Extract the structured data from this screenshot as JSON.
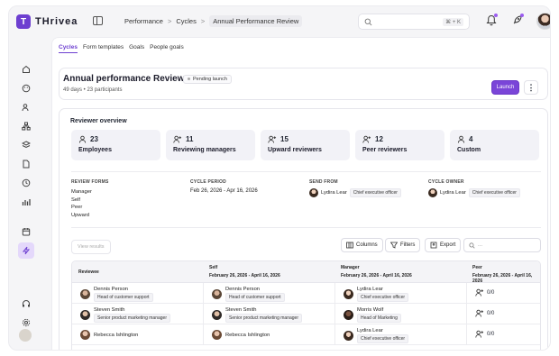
{
  "app": {
    "brand": "THrivea",
    "brand_initial": "T"
  },
  "breadcrumb": [
    "Performance",
    "Cycles",
    "Annual Performance Review"
  ],
  "breadcrumb_sep": ">",
  "search": {
    "shortcut": "⌘ + K"
  },
  "subtabs": [
    "Cycles",
    "Form templates",
    "Goals",
    "People goals"
  ],
  "cycle": {
    "title": "Annual performance Review",
    "status": "Pending launch",
    "meta": "49 days • 23 participants",
    "launch_label": "Launch",
    "more_label": "⋮"
  },
  "overview": {
    "title": "Reviewer overview",
    "stats": [
      {
        "count": "23",
        "label": "Employees",
        "icon": "user-icon"
      },
      {
        "count": "11",
        "label": "Reviewing managers",
        "icon": "user-plus-icon"
      },
      {
        "count": "15",
        "label": "Upward reviewers",
        "icon": "user-plus-icon"
      },
      {
        "count": "12",
        "label": "Peer reviewers",
        "icon": "user-plus-icon"
      },
      {
        "count": "4",
        "label": "Custom",
        "icon": "user-icon"
      }
    ]
  },
  "details": {
    "forms_head": "REVIEW FORMS",
    "forms": [
      "Manager",
      "Self",
      "Peer",
      "Upward"
    ],
    "period_head": "CYCLE PERIOD",
    "period": "Feb 26, 2026 - Apr 16, 2026",
    "send_head": "SEND FROM",
    "send_name": "Lydira Lear",
    "send_role": "Chief executive officer",
    "owner_head": "CYCLE OWNER",
    "owner_name": "Lydira Lear",
    "owner_role": "Chief executive officer"
  },
  "toolbar": {
    "view_results": "View results",
    "columns": "Columns",
    "filters": "Filters",
    "export": "Export",
    "search_placeholder": "..."
  },
  "table": {
    "headers": [
      {
        "label": "Reviewee",
        "sub": ""
      },
      {
        "label": "Self",
        "sub": "February 26, 2026 - April 16, 2026"
      },
      {
        "label": "Manager",
        "sub": "February 26, 2026 - April 16, 2026"
      },
      {
        "label": "Peer",
        "sub": "February 26, 2026 - April 16, 2026"
      }
    ],
    "rows": [
      {
        "reviewee": {
          "name": "Dennis Person",
          "role": "Head of customer support"
        },
        "self": {
          "name": "Dennis Person",
          "role": "Head of customer support"
        },
        "manager": {
          "name": "Lydira Lear",
          "role": "Chief executive officer"
        },
        "peer": "0/0"
      },
      {
        "reviewee": {
          "name": "Steven Smith",
          "role": "Senior product marketing manager"
        },
        "self": {
          "name": "Steven Smith",
          "role": "Senior product marketing manager"
        },
        "manager": {
          "name": "Morris Wolf",
          "role": "Head of Marketing"
        },
        "peer": "0/0"
      },
      {
        "reviewee": {
          "name": "Rebecca Ishlington",
          "role": ""
        },
        "self": {
          "name": "Rebecca Ishlington",
          "role": ""
        },
        "manager": {
          "name": "Lydira Lear",
          "role": "Chief executive officer"
        },
        "peer": "0/0"
      }
    ]
  },
  "colors": {
    "accent": "#7a45d8",
    "stat_bg": "#f2f2f7",
    "notification_dot": "#9b5cf0"
  }
}
